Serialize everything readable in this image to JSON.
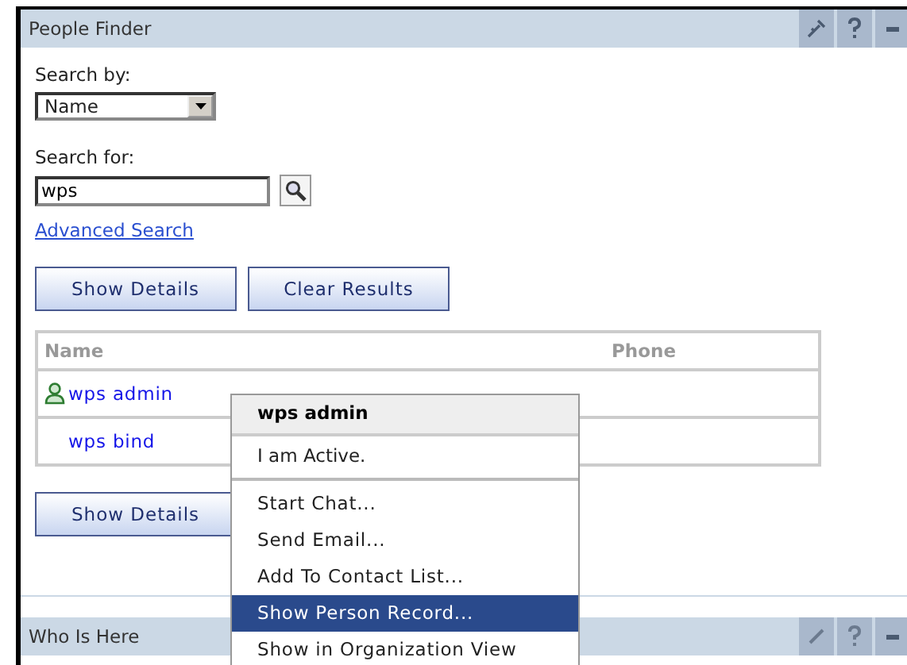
{
  "portlet": {
    "title": "People Finder",
    "search_by_label": "Search by:",
    "search_by_value": "Name",
    "search_for_label": "Search for:",
    "search_for_value": "wps",
    "advanced_link": "Advanced Search",
    "top_buttons": [
      "Show Details",
      "Clear Results"
    ],
    "table": {
      "columns": [
        "Name",
        "Phone"
      ],
      "rows": [
        {
          "name": "wps admin",
          "online": true
        },
        {
          "name": "wps bind",
          "online": false
        }
      ]
    },
    "bottom_buttons": [
      "Show Details"
    ]
  },
  "context_menu": {
    "header": "wps admin",
    "status": "I am Active.",
    "items": [
      {
        "label": "Start Chat...",
        "selected": false
      },
      {
        "label": "Send Email...",
        "selected": false
      },
      {
        "label": "Add To Contact List...",
        "selected": false
      },
      {
        "label": "Show Person Record...",
        "selected": true
      },
      {
        "label": "Show in Organization View",
        "selected": false
      }
    ]
  },
  "second_portlet": {
    "title": "Who Is Here"
  }
}
